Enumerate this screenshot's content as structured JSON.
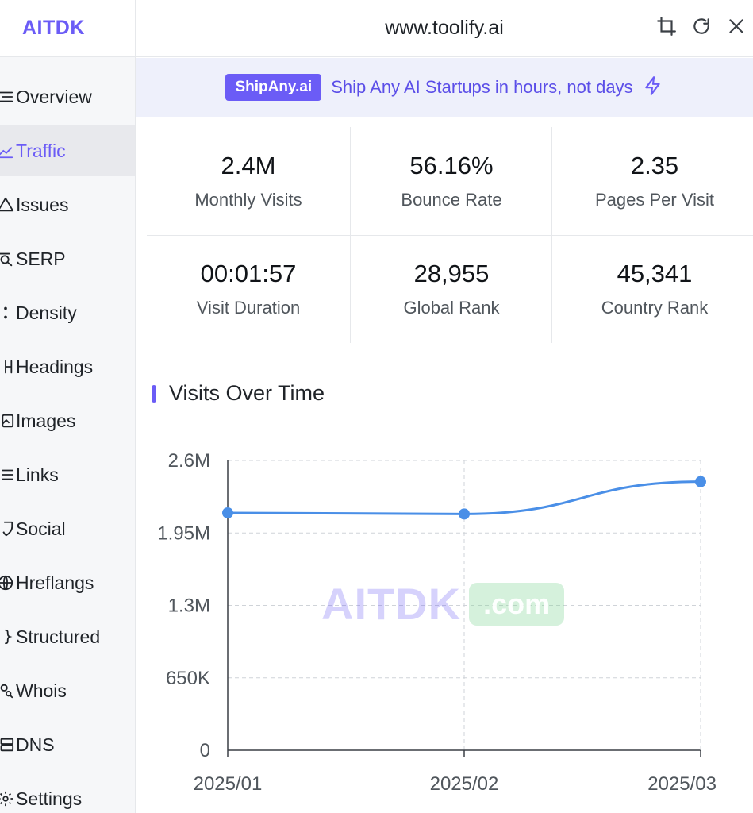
{
  "brand": "AITDK",
  "header": {
    "url": "www.toolify.ai"
  },
  "sidebar": {
    "items": [
      {
        "label": "Overview",
        "icon": "list-icon"
      },
      {
        "label": "Traffic",
        "icon": "trend-icon",
        "active": true
      },
      {
        "label": "Issues",
        "icon": "warning-icon"
      },
      {
        "label": "SERP",
        "icon": "search-doc-icon"
      },
      {
        "label": "Density",
        "icon": "dots-icon"
      },
      {
        "label": "Headings",
        "icon": "heading-icon"
      },
      {
        "label": "Images",
        "icon": "image-icon"
      },
      {
        "label": "Links",
        "icon": "link-list-icon"
      },
      {
        "label": "Social",
        "icon": "shield-icon"
      },
      {
        "label": "Hreflangs",
        "icon": "globe-icon"
      },
      {
        "label": "Structured",
        "icon": "braces-icon"
      },
      {
        "label": "Whois",
        "icon": "user-search-icon"
      },
      {
        "label": "DNS",
        "icon": "server-icon"
      },
      {
        "label": "Settings",
        "icon": "gear-icon"
      }
    ]
  },
  "promo": {
    "badge": "ShipAny.ai",
    "text": "Ship Any AI Startups in hours, not days"
  },
  "stats": [
    {
      "value": "2.4M",
      "label": "Monthly Visits"
    },
    {
      "value": "56.16%",
      "label": "Bounce Rate"
    },
    {
      "value": "2.35",
      "label": "Pages Per Visit"
    },
    {
      "value": "00:01:57",
      "label": "Visit Duration"
    },
    {
      "value": "28,955",
      "label": "Global Rank"
    },
    {
      "value": "45,341",
      "label": "Country Rank"
    }
  ],
  "chart_section": {
    "title": "Visits Over Time"
  },
  "watermark": {
    "main": "AITDK",
    "domain": ".com"
  },
  "colors": {
    "accent": "#6b5cf6",
    "line": "#4a8fe7"
  },
  "chart_data": {
    "type": "line",
    "categories": [
      "2025/01",
      "2025/02",
      "2025/03"
    ],
    "values": [
      2130000,
      2120000,
      2410000
    ],
    "yticks": [
      "0",
      "650K",
      "1.3M",
      "1.95M",
      "2.6M"
    ],
    "ylim": [
      0,
      2600000
    ],
    "grid": true,
    "title": "",
    "xlabel": "",
    "ylabel": ""
  }
}
